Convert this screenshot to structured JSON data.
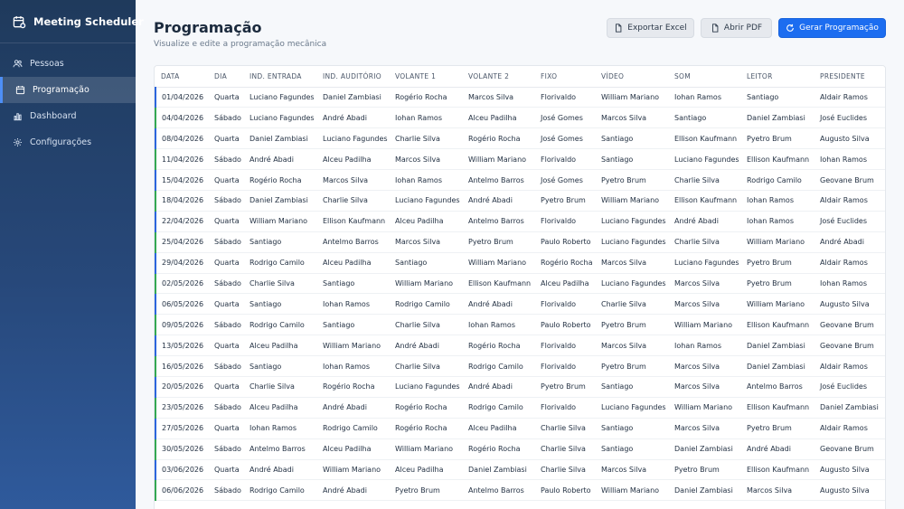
{
  "app": {
    "name": "Meeting Scheduler"
  },
  "sidebar": {
    "items": [
      {
        "label": "Pessoas",
        "icon": "users-icon",
        "active": false
      },
      {
        "label": "Programação",
        "icon": "calendar-icon",
        "active": true
      },
      {
        "label": "Dashboard",
        "icon": "bar-chart-icon",
        "active": false
      },
      {
        "label": "Configurações",
        "icon": "gear-icon",
        "active": false
      }
    ]
  },
  "page": {
    "title": "Programação",
    "subtitle": "Visualize e edite a programação mecânica"
  },
  "toolbar": {
    "excel_label": "Exportar Excel",
    "pdf_label": "Abrir PDF",
    "generate_label": "Gerar Programação"
  },
  "colors": {
    "primary": "#1c6df0",
    "quarta": "#2c66dd",
    "sabado": "#34a853",
    "sidebar": "#27487a"
  },
  "table": {
    "columns": [
      "DATA",
      "DIA",
      "IND. ENTRADA",
      "IND. AUDITÓRIO",
      "VOLANTE 1",
      "VOLANTE 2",
      "FIXO",
      "VÍDEO",
      "SOM",
      "LEITOR",
      "PRESIDENTE"
    ],
    "rows": [
      [
        "01/04/2026",
        "Quarta",
        "Luciano Fagundes",
        "Daniel Zambiasi",
        "Rogério Rocha",
        "Marcos Silva",
        "Florivaldo",
        "William Mariano",
        "Iohan Ramos",
        "Santiago",
        "Aldair Ramos"
      ],
      [
        "04/04/2026",
        "Sábado",
        "Luciano Fagundes",
        "André Abadi",
        "Iohan Ramos",
        "Alceu Padilha",
        "José Gomes",
        "Marcos Silva",
        "Santiago",
        "Daniel Zambiasi",
        "José Euclides"
      ],
      [
        "08/04/2026",
        "Quarta",
        "Daniel Zambiasi",
        "Luciano Fagundes",
        "Charlie Silva",
        "Rogério Rocha",
        "José Gomes",
        "Santiago",
        "Ellison Kaufmann",
        "Pyetro Brum",
        "Augusto Silva"
      ],
      [
        "11/04/2026",
        "Sábado",
        "André Abadi",
        "Alceu Padilha",
        "Marcos Silva",
        "William Mariano",
        "Florivaldo",
        "Santiago",
        "Luciano Fagundes",
        "Ellison Kaufmann",
        "Iohan Ramos"
      ],
      [
        "15/04/2026",
        "Quarta",
        "Rogério Rocha",
        "Marcos Silva",
        "Iohan Ramos",
        "Antelmo Barros",
        "José Gomes",
        "Pyetro Brum",
        "Charlie Silva",
        "Rodrigo Camilo",
        "Geovane Brum"
      ],
      [
        "18/04/2026",
        "Sábado",
        "Daniel Zambiasi",
        "Charlie Silva",
        "Luciano Fagundes",
        "André Abadi",
        "Pyetro Brum",
        "William Mariano",
        "Ellison Kaufmann",
        "Iohan Ramos",
        "Aldair Ramos"
      ],
      [
        "22/04/2026",
        "Quarta",
        "William Mariano",
        "Ellison Kaufmann",
        "Alceu Padilha",
        "Antelmo Barros",
        "Florivaldo",
        "Luciano Fagundes",
        "André Abadi",
        "Iohan Ramos",
        "José Euclides"
      ],
      [
        "25/04/2026",
        "Sábado",
        "Santiago",
        "Antelmo Barros",
        "Marcos Silva",
        "Pyetro Brum",
        "Paulo Roberto",
        "Luciano Fagundes",
        "Charlie Silva",
        "William Mariano",
        "André Abadi"
      ],
      [
        "29/04/2026",
        "Quarta",
        "Rodrigo Camilo",
        "Alceu Padilha",
        "Santiago",
        "William Mariano",
        "Rogério Rocha",
        "Marcos Silva",
        "Luciano Fagundes",
        "Pyetro Brum",
        "Aldair Ramos"
      ],
      [
        "02/05/2026",
        "Sábado",
        "Charlie Silva",
        "Santiago",
        "William Mariano",
        "Ellison Kaufmann",
        "Alceu Padilha",
        "Luciano Fagundes",
        "Marcos Silva",
        "Pyetro Brum",
        "Iohan Ramos"
      ],
      [
        "06/05/2026",
        "Quarta",
        "Santiago",
        "Iohan Ramos",
        "Rodrigo Camilo",
        "André Abadi",
        "Florivaldo",
        "Charlie Silva",
        "Marcos Silva",
        "William Mariano",
        "Augusto Silva"
      ],
      [
        "09/05/2026",
        "Sábado",
        "Rodrigo Camilo",
        "Santiago",
        "Charlie Silva",
        "Iohan Ramos",
        "Paulo Roberto",
        "Pyetro Brum",
        "William Mariano",
        "Ellison Kaufmann",
        "Geovane Brum"
      ],
      [
        "13/05/2026",
        "Quarta",
        "Alceu Padilha",
        "William Mariano",
        "André Abadi",
        "Rogério Rocha",
        "Florivaldo",
        "Marcos Silva",
        "Iohan Ramos",
        "Daniel Zambiasi",
        "Geovane Brum"
      ],
      [
        "16/05/2026",
        "Sábado",
        "Santiago",
        "Iohan Ramos",
        "Charlie Silva",
        "Rodrigo Camilo",
        "Florivaldo",
        "Pyetro Brum",
        "Marcos Silva",
        "Daniel Zambiasi",
        "Aldair Ramos"
      ],
      [
        "20/05/2026",
        "Quarta",
        "Charlie Silva",
        "Rogério Rocha",
        "Luciano Fagundes",
        "André Abadi",
        "Pyetro Brum",
        "Santiago",
        "Marcos Silva",
        "Antelmo Barros",
        "José Euclides"
      ],
      [
        "23/05/2026",
        "Sábado",
        "Alceu Padilha",
        "André Abadi",
        "Rogério Rocha",
        "Rodrigo Camilo",
        "Florivaldo",
        "Luciano Fagundes",
        "William Mariano",
        "Ellison Kaufmann",
        "Daniel Zambiasi"
      ],
      [
        "27/05/2026",
        "Quarta",
        "Iohan Ramos",
        "Rodrigo Camilo",
        "Rogério Rocha",
        "Alceu Padilha",
        "Charlie Silva",
        "Santiago",
        "Marcos Silva",
        "Pyetro Brum",
        "Aldair Ramos"
      ],
      [
        "30/05/2026",
        "Sábado",
        "Antelmo Barros",
        "Alceu Padilha",
        "William Mariano",
        "Rogério Rocha",
        "Charlie Silva",
        "Santiago",
        "Daniel Zambiasi",
        "André Abadi",
        "Geovane Brum"
      ],
      [
        "03/06/2026",
        "Quarta",
        "André Abadi",
        "William Mariano",
        "Alceu Padilha",
        "Daniel Zambiasi",
        "Charlie Silva",
        "Marcos Silva",
        "Pyetro Brum",
        "Ellison Kaufmann",
        "Augusto Silva"
      ],
      [
        "06/06/2026",
        "Sábado",
        "Rodrigo Camilo",
        "André Abadi",
        "Pyetro Brum",
        "Antelmo Barros",
        "Paulo Roberto",
        "William Mariano",
        "Daniel Zambiasi",
        "Marcos Silva",
        "Augusto Silva"
      ]
    ]
  }
}
